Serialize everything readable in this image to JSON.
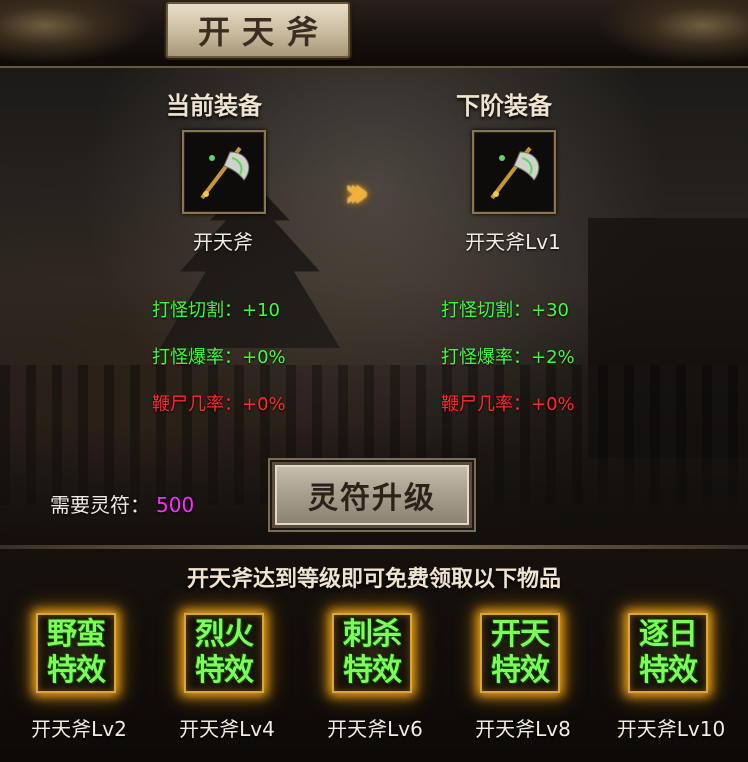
{
  "window": {
    "title": "开天斧"
  },
  "current": {
    "heading": "当前装备",
    "item_name": "开天斧",
    "icon": "axe-icon",
    "stats": [
      {
        "label": "打怪切割：",
        "value": "+10",
        "color": "#3dff3d"
      },
      {
        "label": "打怪爆率：",
        "value": "+0%",
        "color": "#3dff3d"
      },
      {
        "label": "鞭尸几率：",
        "value": "+0%",
        "color": "#ff2a2a"
      }
    ]
  },
  "next": {
    "heading": "下阶装备",
    "item_name": "开天斧Lv1",
    "icon": "axe-icon",
    "stats": [
      {
        "label": "打怪切割：",
        "value": "+30",
        "color": "#3dff3d"
      },
      {
        "label": "打怪爆率：",
        "value": "+2%",
        "color": "#3dff3d"
      },
      {
        "label": "鞭尸几率：",
        "value": "+0%",
        "color": "#ff2a2a"
      }
    ]
  },
  "arrow_icon": "double-chevron-right-icon",
  "requirement": {
    "label": "需要灵符：",
    "value": "500",
    "value_color": "#ff2dff"
  },
  "upgrade_button": {
    "label": "灵符升级"
  },
  "rewards_section": {
    "title": "开天斧达到等级即可免费领取以下物品",
    "items": [
      {
        "line1": "野蛮",
        "line2": "特效",
        "level": "开天斧Lv2"
      },
      {
        "line1": "烈火",
        "line2": "特效",
        "level": "开天斧Lv4"
      },
      {
        "line1": "刺杀",
        "line2": "特效",
        "level": "开天斧Lv6"
      },
      {
        "line1": "开天",
        "line2": "特效",
        "level": "开天斧Lv8"
      },
      {
        "line1": "逐日",
        "line2": "特效",
        "level": "开天斧Lv10"
      }
    ]
  }
}
